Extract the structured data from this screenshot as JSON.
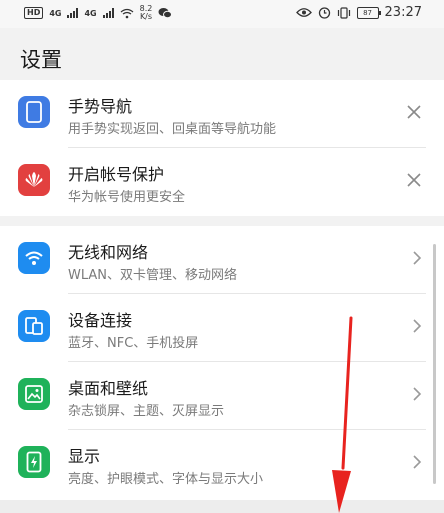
{
  "status_bar": {
    "hd": "HD",
    "net1": "4G",
    "net2": "4G",
    "speed_value": "8.2",
    "speed_unit": "K/s",
    "battery": "87",
    "time": "23:27"
  },
  "page": {
    "title": "设置"
  },
  "suggestions": [
    {
      "title": "手势导航",
      "subtitle": "用手势实现返回、回桌面等导航功能",
      "icon": "phone-gesture-icon",
      "color": "#3f7be3"
    },
    {
      "title": "开启帐号保护",
      "subtitle": "华为帐号使用更安全",
      "icon": "huawei-logo-icon",
      "color": "#e2403f"
    }
  ],
  "settings": [
    {
      "title": "无线和网络",
      "subtitle": "WLAN、双卡管理、移动网络",
      "icon": "wifi-icon",
      "color": "#1e8cf0"
    },
    {
      "title": "设备连接",
      "subtitle": "蓝牙、NFC、手机投屏",
      "icon": "device-connect-icon",
      "color": "#1e8cf0"
    },
    {
      "title": "桌面和壁纸",
      "subtitle": "杂志锁屏、主题、灭屏显示",
      "icon": "wallpaper-icon",
      "color": "#1fb25a"
    },
    {
      "title": "显示",
      "subtitle": "亮度、护眼模式、字体与显示大小",
      "icon": "display-icon",
      "color": "#1fb25a"
    }
  ],
  "annotation": {
    "arrow_color": "#e8231f"
  }
}
